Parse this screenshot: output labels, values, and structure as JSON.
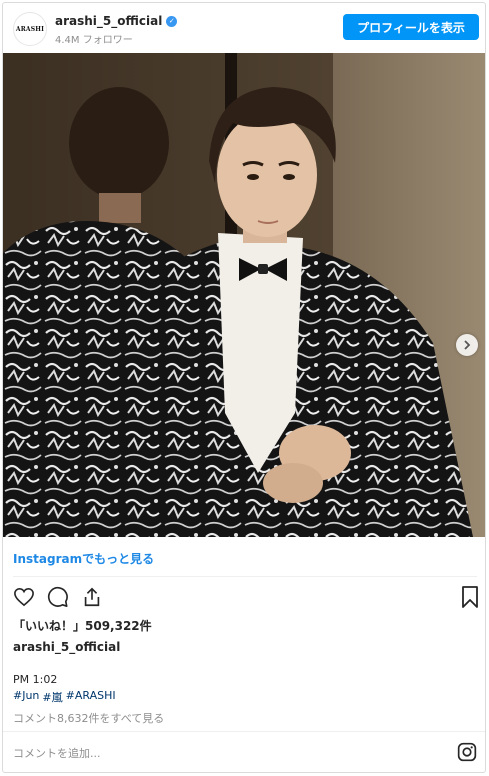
{
  "header": {
    "avatar_text": "ARASHI",
    "username": "arashi_5_official",
    "verified_symbol": "✓",
    "followers": "4.4M フォロワー",
    "profile_button": "プロフィールを表示"
  },
  "media": {
    "icons": {
      "next": "chevron-right-icon"
    },
    "dots": 3,
    "active_dot": 1
  },
  "more_link": "Instagramでもっと見る",
  "actions": {
    "icons": [
      "heart-icon",
      "comment-icon",
      "share-icon",
      "bookmark-icon"
    ]
  },
  "likes": "「いいね！」509,322件",
  "owner": "arashi_5_official",
  "time": "PM 1:02",
  "hashtags": [
    "#Jun",
    "#嵐",
    "#ARASHI"
  ],
  "view_comments": "コメント8,632件をすべて見る",
  "comment": {
    "placeholder": "コメントを追加..."
  },
  "colors": {
    "primary_button": "#0095f6",
    "link": "#1e88e5",
    "hashtag": "#00376b",
    "muted": "#8e8e8e"
  }
}
